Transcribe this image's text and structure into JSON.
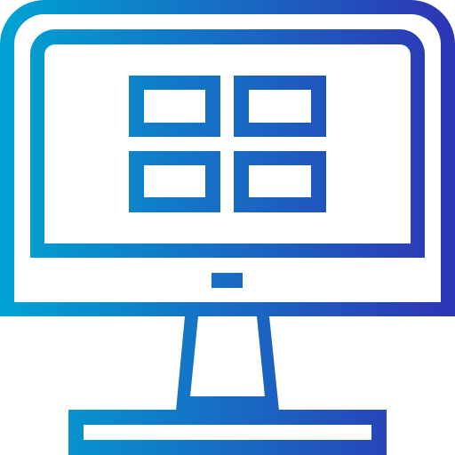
{
  "icon": {
    "name": "computer-monitor-icon",
    "gradient_start": "#00A3D3",
    "gradient_end": "#2E35B5"
  }
}
